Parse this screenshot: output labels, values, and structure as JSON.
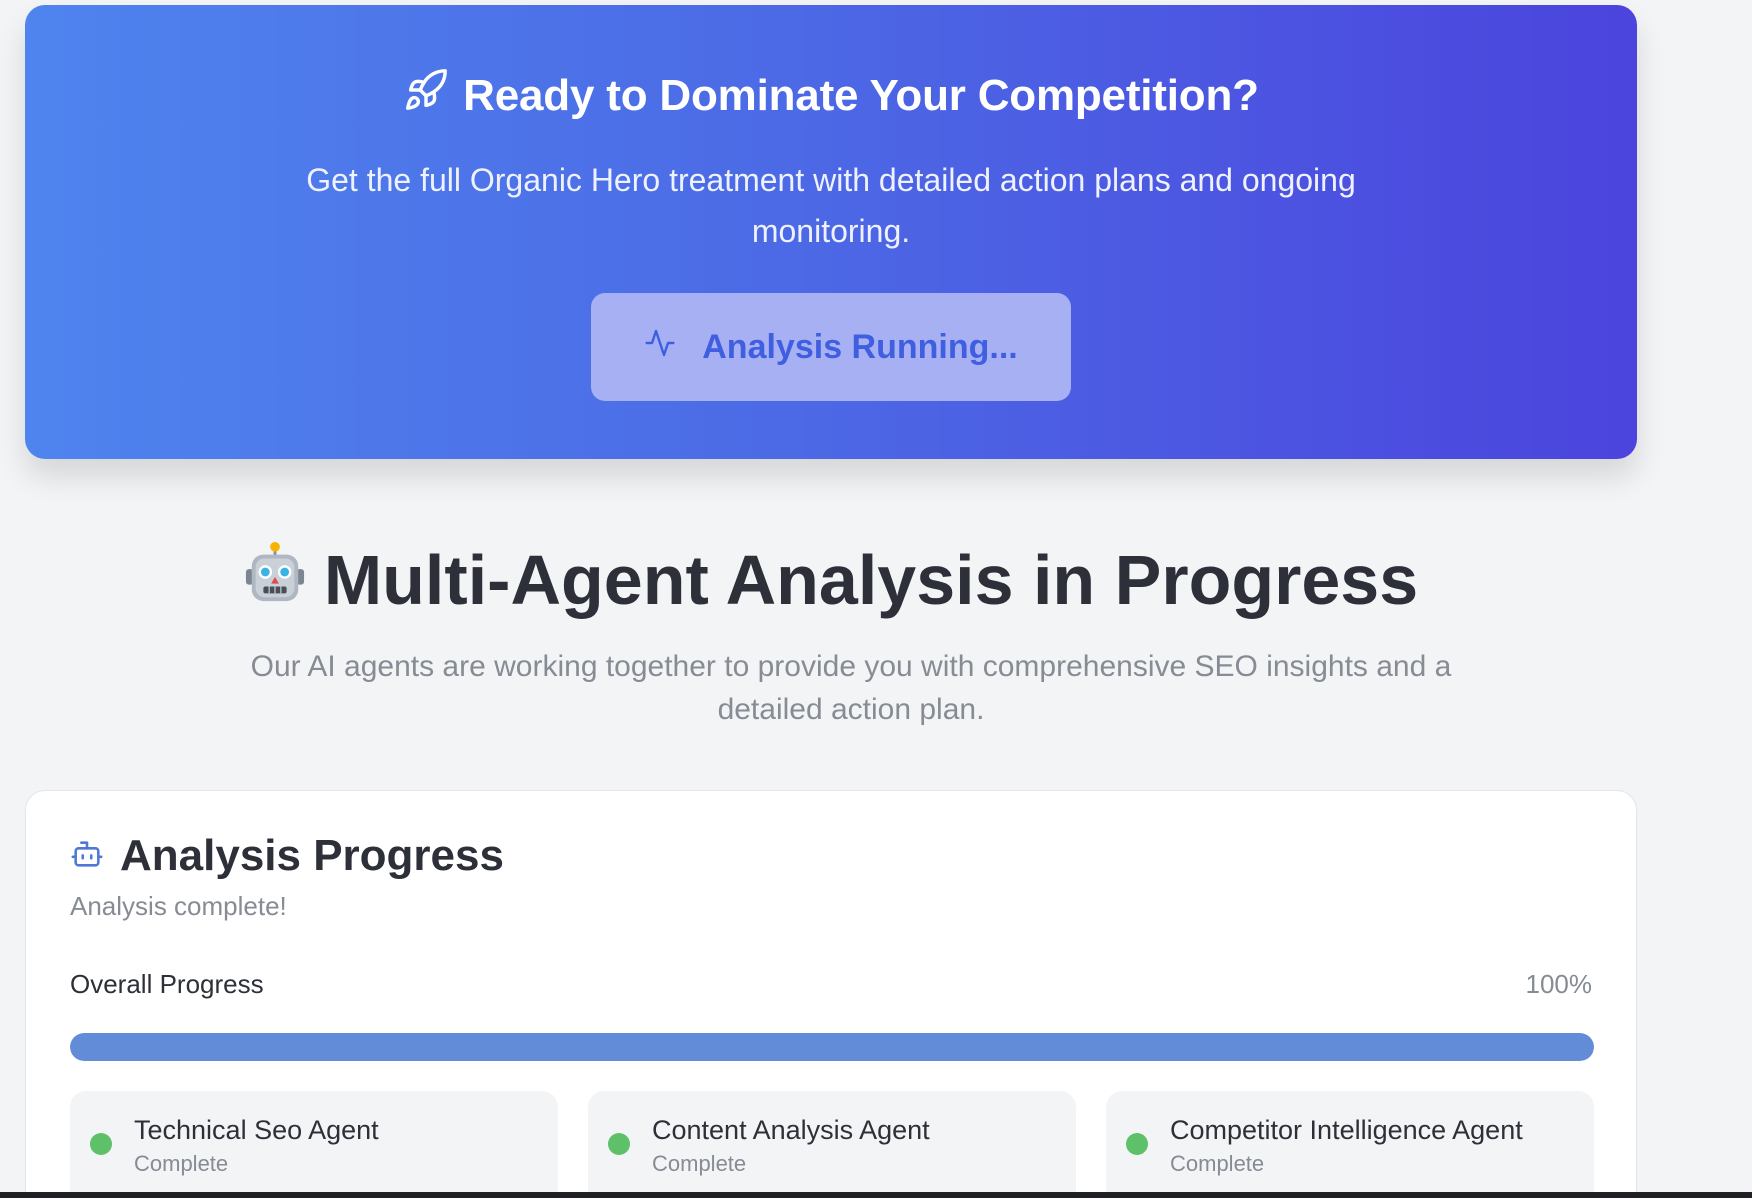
{
  "hero": {
    "title": "Ready to Dominate Your Competition?",
    "subtitle": "Get the full Organic Hero treatment with detailed action plans and ongoing monitoring.",
    "button_label": "Analysis Running...",
    "icon": "rocket-icon",
    "button_icon": "activity-pulse-icon"
  },
  "section": {
    "title": "Multi-Agent Analysis in Progress",
    "subtitle": "Our AI agents are working together to provide you with comprehensive SEO insights and a detailed action plan.",
    "icon": "robot-emoji"
  },
  "progress_card": {
    "title": "Analysis Progress",
    "status": "Analysis complete!",
    "overall_label": "Overall Progress",
    "overall_percent_text": "100%",
    "overall_fraction": 1.0,
    "icon": "bot-icon",
    "agents": [
      {
        "name": "Technical Seo Agent",
        "status": "Complete"
      },
      {
        "name": "Content Analysis Agent",
        "status": "Complete"
      },
      {
        "name": "Competitor Intelligence Agent",
        "status": "Complete"
      }
    ]
  },
  "colors": {
    "hero_gradient_start": "#4f84ee",
    "hero_gradient_end": "#4b44dd",
    "progress_fill": "#628bd8",
    "complete_dot": "#5fc06a"
  }
}
